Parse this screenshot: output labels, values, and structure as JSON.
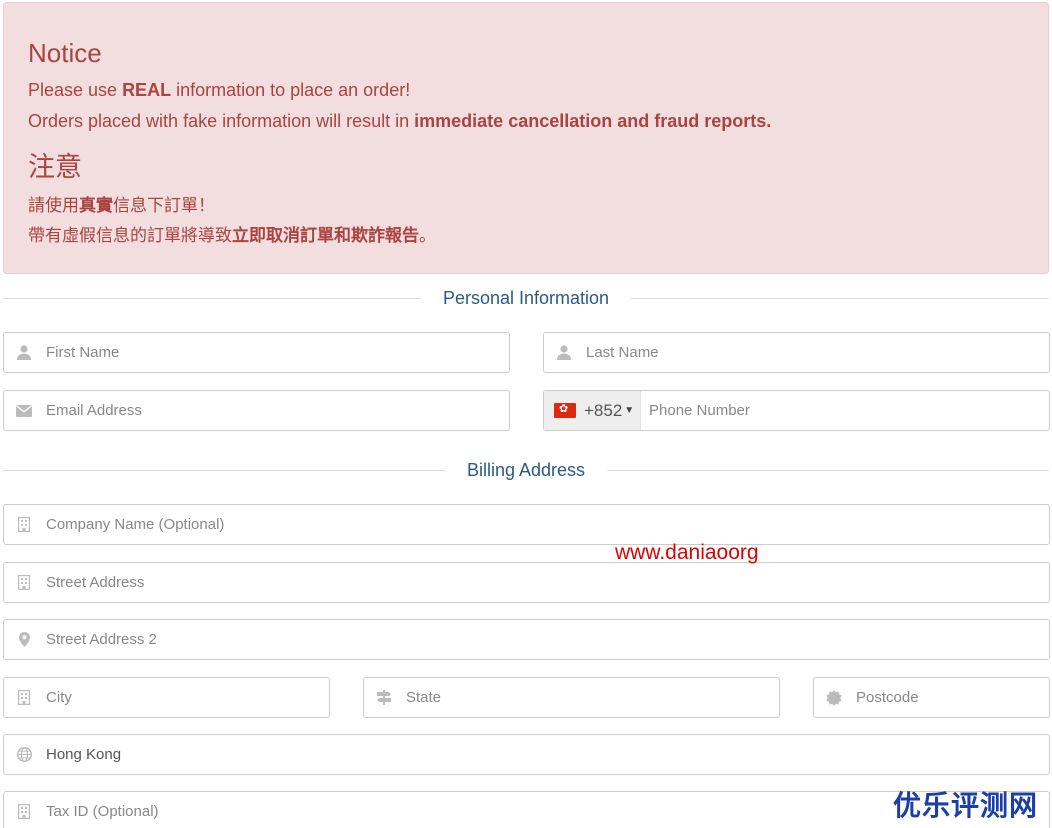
{
  "notice": {
    "title_en": "Notice",
    "line1_pre": "Please use ",
    "line1_bold": "REAL",
    "line1_post": " information to place an order!",
    "line2_pre": "Orders placed with fake information will result in ",
    "line2_bold": "immediate cancellation and fraud reports.",
    "title_zh": "注意",
    "zh_line1_pre": "請使用",
    "zh_line1_bold": "真實",
    "zh_line1_post": "信息下訂單！",
    "zh_line2_pre": "帶有虛假信息的訂單將導致",
    "zh_line2_bold": "立即取消訂單和欺詐報告",
    "zh_line2_post": "。"
  },
  "personal": {
    "section_title": "Personal Information",
    "first_name_placeholder": "First Name",
    "last_name_placeholder": "Last Name",
    "email_placeholder": "Email Address",
    "phone_code": "+852",
    "phone_placeholder": "Phone Number"
  },
  "billing": {
    "section_title": "Billing Address",
    "company_placeholder": "Company Name (Optional)",
    "street_placeholder": "Street Address",
    "street2_placeholder": "Street Address 2",
    "city_placeholder": "City",
    "state_placeholder": "State",
    "postcode_placeholder": "Postcode",
    "country_value": "Hong Kong",
    "taxid_placeholder": "Tax ID (Optional)"
  },
  "watermarks": {
    "site": "www.daniaoorg",
    "brand": "优乐评测网"
  },
  "colors": {
    "notice_bg": "#f2dede",
    "notice_text": "#a94442",
    "section_title": "#2a5a87",
    "watermark_red": "#e00000",
    "watermark_blue": "#1c3ea8"
  }
}
